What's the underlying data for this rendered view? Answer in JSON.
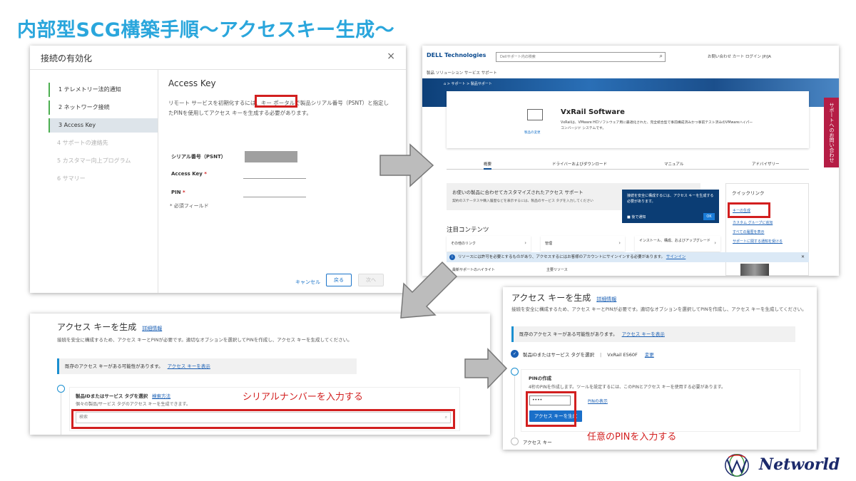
{
  "slide": {
    "title": "内部型SCG構築手順〜アクセスキー生成〜",
    "brand": "Networld"
  },
  "wizard": {
    "title": "接続の有効化",
    "close": "×",
    "steps": [
      {
        "label": "1  テレメトリー法的通知"
      },
      {
        "label": "2  ネットワーク接続"
      },
      {
        "label": "3  Access Key"
      },
      {
        "label": "4  サポートの連絡先"
      },
      {
        "label": "5  カスタマー向上プログラム"
      },
      {
        "label": "6  サマリー"
      }
    ],
    "heading": "Access Key",
    "description": "リモート サービスを初期化するには、キー ポータルで製品シリアル番号（PSNT）と指定したPINを使用してアクセス キーを生成する必要があります。",
    "serial_label": "シリアル番号（PSNT）",
    "access_key_label": "Access Key",
    "pin_label": "PIN",
    "required_mark": "*",
    "required_note": "* 必須フィールド",
    "cancel": "キャンセル",
    "back": "戻る",
    "next": "次へ"
  },
  "dell": {
    "logo": "DELL Technologies",
    "search_placeholder": "Dellサポート内の検索",
    "top_links": "お問い合わせ   カート   ログイン   JP/JA",
    "nav": "製品    ソリューション    サービス    サポート",
    "breadcrumb": "⌂  >  サポート  >  製品サポート",
    "product_name": "VxRail Software",
    "product_desc": "VxRailは、VMware HCIソフトウェア用に最適化された、完全統合型で事前構成済みかつ事前テスト済みのVMwareハイパーコンバージド システムです。",
    "product_change": "製品の変更",
    "side_tab": "サポートへのお問い合わせ",
    "tabs": [
      "概要",
      "ドライバーおよびダウンロード",
      "マニュアル",
      "アドバイザリー"
    ],
    "custom_title": "お使いの製品に合わせてカスタマイズされたアクセス サポート",
    "custom_desc": "契約のステータスや購入履歴などを表示するには、製品のサービス タグを入力してください",
    "tooltip_text": "接続を安全に構成するには、アクセス キーを生成する必要があります。",
    "tooltip_checkbox": "後で通知",
    "tooltip_ok": "OK",
    "quick_title": "クイックリンク",
    "quick_links": [
      "キーの生成",
      "カスタム グループに追加",
      "すべての履歴を表示",
      "サポートに関する通知を受ける"
    ],
    "featured_title": "注目コンテンツ",
    "featured_cards": [
      "その他のリンク",
      "管理",
      "インストール、構成、およびアップグレード"
    ],
    "notice_text": "リソースには許可を必要とするものがあり、アクセスするにはお客様のアカウントにサインインする必要があります。",
    "notice_signin": "サインイン",
    "bottom_items": [
      "最新サポートのハイライト",
      "主要リソース"
    ]
  },
  "gen_left": {
    "title": "アクセス キーを生成",
    "more": "詳細情報",
    "description": "接続を安全に構成するため、アクセス キーとPINが必要です。適切なオプションを選択してPINを作成し、アクセス キーを生成してください。",
    "info": "既存のアクセス キーがある可能性があります。",
    "info_link": "アクセス キーを表示",
    "panel_title": "製品IDまたはサービス タグを選択",
    "panel_link": "検索方法",
    "panel_sub": "個々の製品/サービス タグのアクセス キーを生成できます。",
    "search_placeholder": "検索",
    "search_icon": "⌕"
  },
  "gen_right": {
    "title": "アクセス キーを生成",
    "more": "詳細情報",
    "description": "接続を安全に構成するため、アクセス キーとPINが必要です。適切なオプションを選択してPINを作成し、アクセス キーを生成してください。",
    "info": "既存のアクセス キーがある可能性があります。",
    "info_link": "アクセス キーを表示",
    "product_label": "製品IDまたはサービス タグを選択",
    "product_value": "VxRail E560F",
    "change": "変更",
    "pin_title": "PINの作成",
    "pin_desc": "4桁のPINを作成します。ツールを設定するには、このPINとアクセス キーを使用する必要があります。",
    "pin_value": "••••",
    "pin_show": "PINの表示",
    "generate_button": "アクセス キーを生成",
    "access_key_label": "アクセス キー"
  },
  "annotations": {
    "serial_note": "シリアルナンバーを入力する",
    "pin_note": "任意のPINを入力する"
  },
  "colors": {
    "title": "#2aa6dc",
    "highlight": "#d21f1f",
    "dell_blue": "#0a4a8f",
    "brand": "#1c2a6b"
  }
}
